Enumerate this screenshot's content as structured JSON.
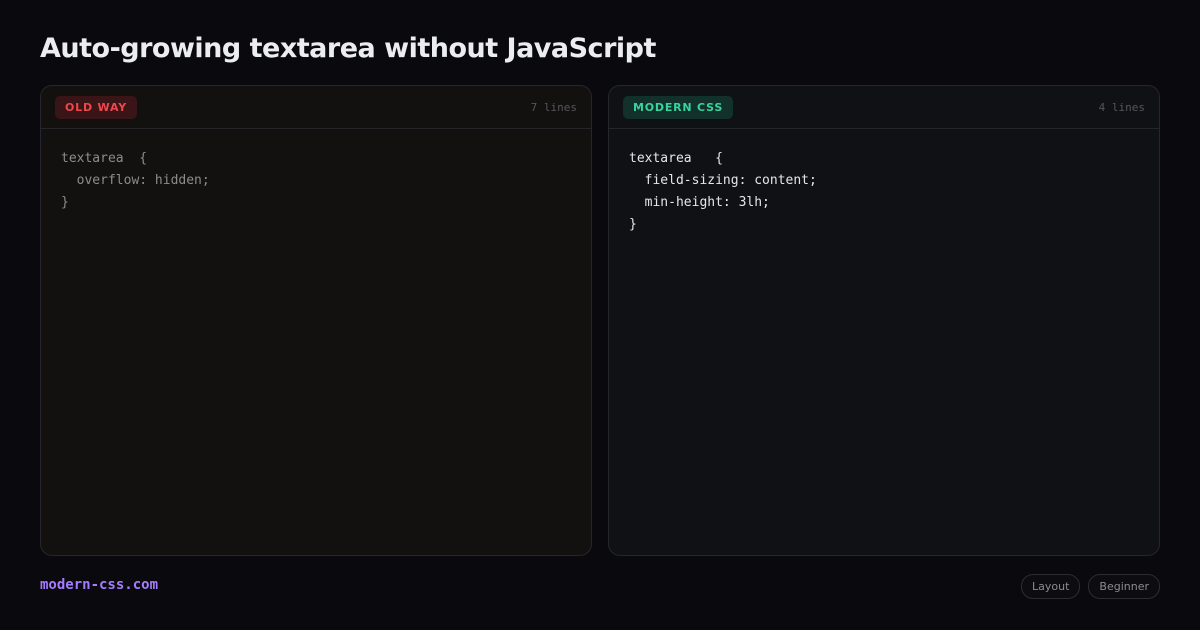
{
  "page": {
    "title": "Auto-growing textarea without JavaScript"
  },
  "old_panel": {
    "badge": "OLD WAY",
    "line_count": "7 lines",
    "code": "textarea  {\n  overflow: hidden;\n}"
  },
  "modern_panel": {
    "badge": "MODERN CSS",
    "line_count": "4 lines",
    "code": "textarea   {\n  field-sizing: content;\n  min-height: 3lh;\n}"
  },
  "footer": {
    "brand": "modern-css.com",
    "tags": [
      "Layout",
      "Beginner"
    ]
  },
  "colors": {
    "old_accent": "#f0474d",
    "modern_accent": "#38d39f",
    "brand": "#a57cff"
  }
}
